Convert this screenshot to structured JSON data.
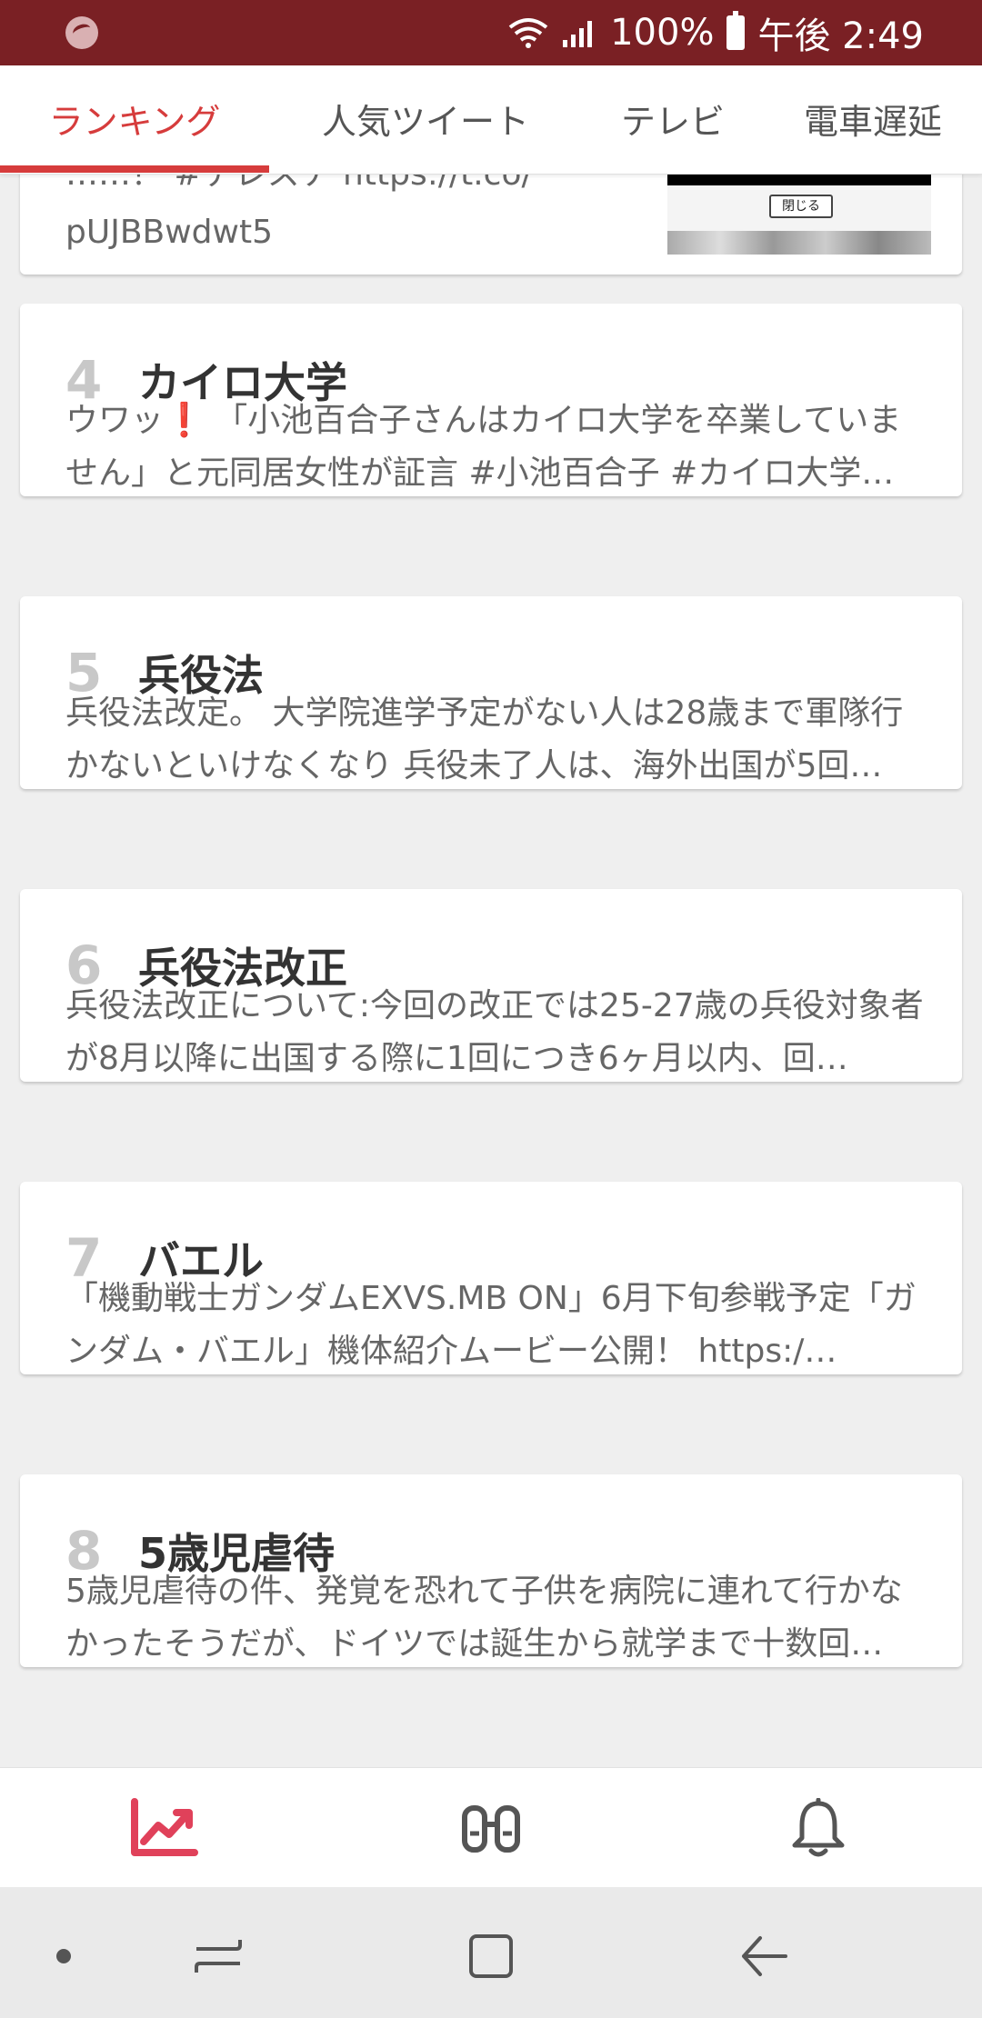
{
  "status_bar": {
    "battery": "100%",
    "time": "午後 2:49"
  },
  "tabs": [
    {
      "label": "ランキング",
      "active": true
    },
    {
      "label": "人気ツイート",
      "active": false
    },
    {
      "label": "テレビ",
      "active": false
    },
    {
      "label": "電車遅延",
      "active": false
    }
  ],
  "partial_card": {
    "text_line1": "……？ #テレスナ https://t.co/",
    "text_line2": "pUJBBwdwt5",
    "thumbnail_button": "閉じる"
  },
  "ranking": [
    {
      "rank": "4",
      "title": "カイロ大学",
      "desc": "ウワッ❗ 「小池百合子さんはカイロ大学を卒業していません」と元同居女性が証言 #小池百合子 #カイロ大学…"
    },
    {
      "rank": "5",
      "title": "兵役法",
      "desc": "兵役法改定。 大学院進学予定がない人は28歳まで軍隊行かないといけなくなり 兵役未了人は、海外出国が5回…"
    },
    {
      "rank": "6",
      "title": "兵役法改正",
      "desc": "兵役法改正について:今回の改正では25-27歳の兵役対象者が8月以降に出国する際に1回につき6ヶ月以内、回…"
    },
    {
      "rank": "7",
      "title": "バエル",
      "desc": "「機動戦士ガンダムEXVS.MB ON」6月下旬参戦予定「ガンダム・バエル」機体紹介ムービー公開！ https:/…"
    },
    {
      "rank": "8",
      "title": "5歳児虐待",
      "desc": "5歳児虐待の件、発覚を恐れて子供を病院に連れて行かなかったそうだが、ドイツでは誕生から就学まで十数回…"
    }
  ],
  "bottom_nav": [
    {
      "icon": "trending-chart-icon",
      "active": true
    },
    {
      "icon": "binoculars-icon",
      "active": false
    },
    {
      "icon": "bell-icon",
      "active": false
    }
  ],
  "system_nav": [
    "dot-icon",
    "recent-apps-icon",
    "home-icon",
    "back-icon"
  ],
  "colors": {
    "status_bar": "#7a2024",
    "accent": "#d63c3c",
    "rank_number": "#c8c8c8"
  }
}
